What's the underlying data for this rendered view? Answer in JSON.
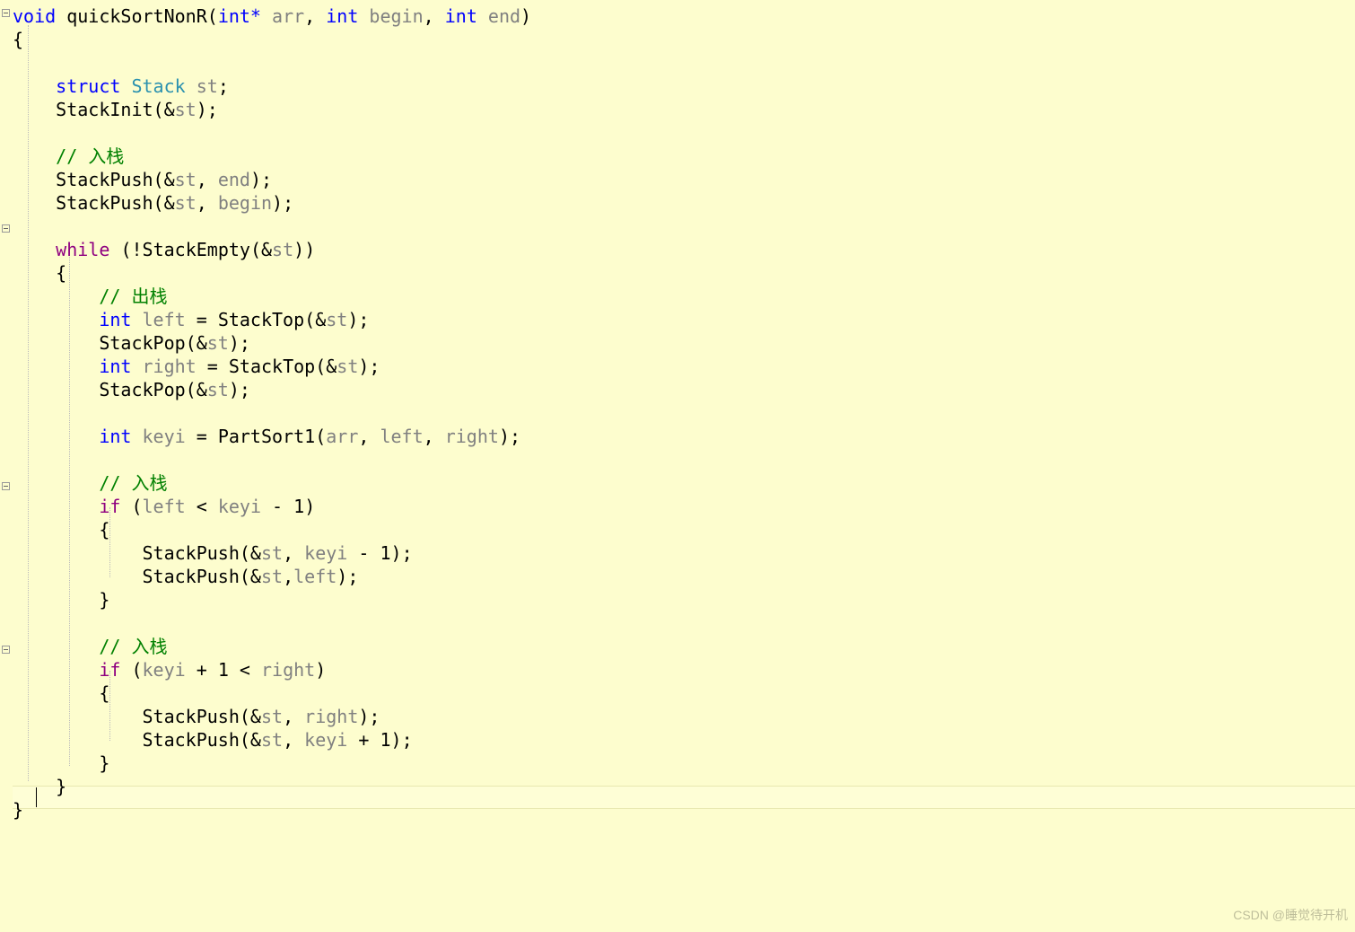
{
  "watermark": "CSDN @睡觉待开机",
  "code": {
    "kw": {
      "void": "void",
      "int": "int",
      "intptr": "int*",
      "struct": "struct",
      "while": "while",
      "if": "if"
    },
    "fn": "quickSortNonR",
    "params": {
      "p1": "arr",
      "p2": "begin",
      "p3": "end"
    },
    "types": {
      "stack": "Stack"
    },
    "vars": {
      "st": "st",
      "left": "left",
      "right": "right",
      "keyi": "keyi"
    },
    "calls": {
      "StackInit": "StackInit",
      "StackPush": "StackPush",
      "StackEmpty": "StackEmpty",
      "StackTop": "StackTop",
      "StackPop": "StackPop",
      "PartSort1": "PartSort1"
    },
    "comments": {
      "push1": "// 入栈",
      "pop": "// 出栈",
      "push2": "// 入栈",
      "push3": "// 入栈"
    },
    "punct": {
      "lparen": "(",
      "rparen": ")",
      "lbrace": "{",
      "rbrace": "}",
      "comma": ",",
      "semi": ";",
      "amp": "&",
      "bang": "!",
      "eq": "=",
      "lt": "<",
      "minus": "-",
      "plus": "+",
      "sp": " "
    },
    "num": {
      "one": "1"
    }
  }
}
